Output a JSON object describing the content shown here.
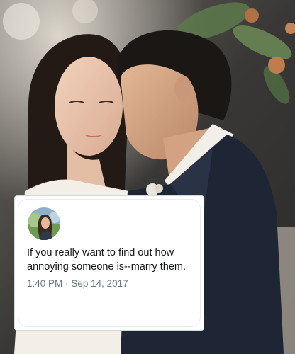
{
  "tweet": {
    "text": "If you really want to find out how annoying someone is--marry them.",
    "time": "1:40 PM",
    "separator": "·",
    "date": "Sep 14, 2017"
  },
  "colors": {
    "text": "#14171a",
    "meta": "#657786",
    "card_border": "#cfd9de"
  }
}
